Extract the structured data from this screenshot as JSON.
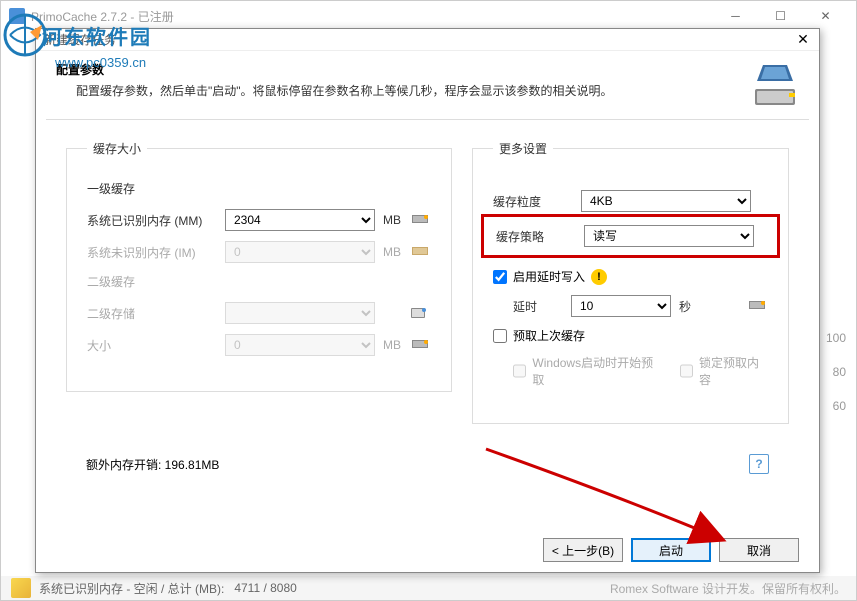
{
  "main_window": {
    "title": "PrimoCache 2.7.2 - 已注册"
  },
  "watermark": {
    "name": "河东软件园",
    "url": "www.pc0359.cn"
  },
  "status_bar": {
    "text": "系统已识别内存 - 空闲 / 总计 (MB):",
    "values": "4711 / 8080",
    "copyright": "Romex Software 设计开发。保留所有权利。"
  },
  "bg_values": [
    "100",
    "80",
    "60"
  ],
  "dialog": {
    "title": "新建缓存任务",
    "header_title": "配置参数",
    "header_desc": "配置缓存参数，然后单击\"启动\"。将鼠标停留在参数名称上等候几秒，程序会显示该参数的相关说明。",
    "cache_size": {
      "legend": "缓存大小",
      "l1_label": "一级缓存",
      "sys_mem_label": "系统已识别内存 (MM)",
      "sys_mem_value": "2304",
      "sys_mem_unit": "MB",
      "unrec_mem_label": "系统未识别内存 (IM)",
      "unrec_mem_value": "0",
      "unrec_mem_unit": "MB",
      "l2_label": "二级缓存",
      "l2_storage_label": "二级存储",
      "l2_size_label": "大小",
      "l2_size_value": "0",
      "l2_size_unit": "MB"
    },
    "more_settings": {
      "legend": "更多设置",
      "block_size_label": "缓存粒度",
      "block_size_value": "4KB",
      "strategy_label": "缓存策略",
      "strategy_value": "读写",
      "defer_write_label": "启用延时写入",
      "delay_label": "延时",
      "delay_value": "10",
      "delay_unit": "秒",
      "prefetch_label": "预取上次缓存",
      "prefetch_boot_label": "Windows启动时开始预取",
      "prefetch_lock_label": "锁定预取内容"
    },
    "extra_mem": "额外内存开销: 196.81MB",
    "buttons": {
      "back": "< 上一步(B)",
      "start": "启动",
      "cancel": "取消"
    }
  }
}
